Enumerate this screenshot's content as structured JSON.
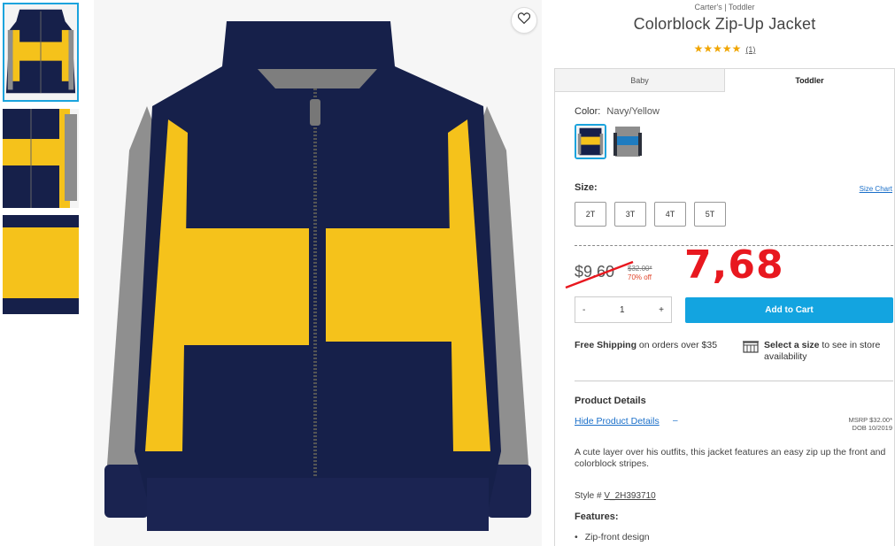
{
  "product": {
    "brand_line": "Carter's | Toddler",
    "title": "Colorblock Zip-Up Jacket",
    "stars": "★★★★★",
    "review_count": "(1)"
  },
  "tabs": [
    {
      "label": "Baby",
      "active": false
    },
    {
      "label": "Toddler",
      "active": true
    }
  ],
  "color": {
    "label": "Color:",
    "selected": "Navy/Yellow",
    "swatches": [
      "navy-yellow",
      "gray-blue"
    ]
  },
  "size": {
    "label": "Size:",
    "chart_link": "Size Chart",
    "options": [
      "2T",
      "3T",
      "4T",
      "5T"
    ]
  },
  "price": {
    "sale": "$9.60",
    "original": "$32.00*",
    "discount": "70% off",
    "annotation": "7,68"
  },
  "cart": {
    "qty_minus": "-",
    "qty_value": "1",
    "qty_plus": "+",
    "add_label": "Add to Cart"
  },
  "shipping": {
    "bold": "Free Shipping",
    "text": " on orders over $35"
  },
  "store": {
    "bold": "Select a size",
    "text": " to see in store availability"
  },
  "details": {
    "heading": "Product Details",
    "hide_link": "Hide Product Details",
    "hide_dash": "–",
    "msrp": "MSRP $32.00*",
    "dob": "DOB 10/2019",
    "description": "A cute layer over his outfits, this jacket features an easy zip up the front and colorblock stripes.",
    "style_label": "Style # ",
    "style_value": "V_2H393710",
    "features_heading": "Features:",
    "features": [
      "Zip-front design"
    ]
  },
  "colors": {
    "navy": "#16204a",
    "yellow": "#f5c21b",
    "gray": "#8d8d8d",
    "accent": "#13a4e0",
    "sale_red": "#e0452b",
    "annotation_red": "#e8181f"
  }
}
